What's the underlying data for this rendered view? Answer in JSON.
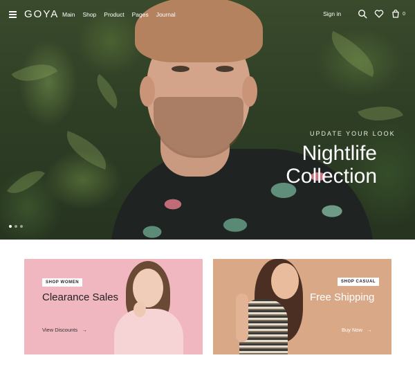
{
  "header": {
    "logo": "GOYA",
    "nav": [
      "Main",
      "Shop",
      "Product",
      "Pages",
      "Journal"
    ],
    "sign_in": "Sign in",
    "cart_count": "0"
  },
  "hero": {
    "eyebrow": "UPDATE YOUR LOOK",
    "title_line1": "Nightlife",
    "title_line2": "Collection",
    "slides": 3,
    "active_slide": 1
  },
  "cards": [
    {
      "tag": "SHOP WOMEN",
      "title": "Clearance Sales",
      "link": "View Discounts",
      "background": "#f0b7c0"
    },
    {
      "tag": "SHOP CASUAL",
      "title": "Free Shipping",
      "link": "Buy Now",
      "background": "#d9a987"
    }
  ],
  "icons": {
    "menu": "menu-icon",
    "search": "search-icon",
    "wishlist": "heart-icon",
    "cart": "cart-icon",
    "arrow": "arrow-right-icon"
  }
}
